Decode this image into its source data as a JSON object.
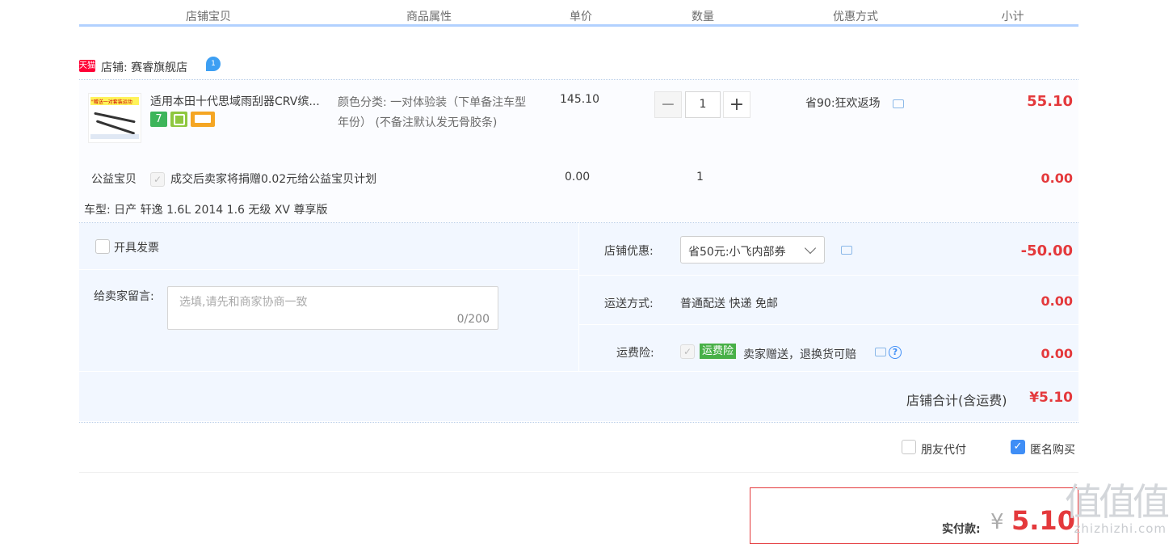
{
  "header": {
    "columns": [
      "店铺宝贝",
      "商品属性",
      "单价",
      "数量",
      "优惠方式",
      "小计"
    ]
  },
  "shop": {
    "badge": "天猫",
    "name": "店铺: 赛睿旗舰店",
    "chat_icon": "wangwang-chat-icon"
  },
  "item": {
    "thumbnail_caption": "\"赠送一对套装运动",
    "title": "适用本田十代思域雨刮器CRV缤...",
    "badges": [
      {
        "label": "7",
        "color": "#3db55a"
      },
      {
        "label": "",
        "color": "#8ec73f"
      },
      {
        "label": "",
        "color": "#f5a623"
      }
    ],
    "props": "颜色分类: 一对体验装（下单备注车型年份） (不备注默认发无骨胶条)",
    "unit_price": "145.10",
    "quantity": "1",
    "minus_label": "−",
    "plus_label": "+",
    "discount": "省90:狂欢返场",
    "subtotal": "55.10"
  },
  "charity": {
    "label": "公益宝贝",
    "check": "✓",
    "text": "成交后卖家将捐赠0.02元给公益宝贝计划",
    "price": "0.00",
    "quantity": "1",
    "subtotal": "0.00"
  },
  "vehicle": "车型: 日产 轩逸 1.6L 2014 1.6 无级 XV 尊享版",
  "options": {
    "invoice_label": "开具发票",
    "message_label": "给卖家留言:",
    "message_placeholder": "选填,请先和商家协商一致",
    "message_counter": "0/200",
    "coupon_label": "店铺优惠:",
    "coupon_value": "省50元:小飞内部券",
    "coupon_amount": "-50.00",
    "shipping_label": "运送方式:",
    "shipping_value": "普通配送 快递 免邮",
    "shipping_amount": "0.00",
    "insurance_label": "运费险:",
    "insurance_check": "✓",
    "insurance_badge": "运费险",
    "insurance_text": "卖家赠送，退换货可赔",
    "insurance_help": "?",
    "insurance_amount": "0.00",
    "shop_total_label": "店铺合计(含运费)",
    "shop_total_value": "¥5.10"
  },
  "footer_options": {
    "friend_pay_label": "朋友代付",
    "anonymous_label": "匿名购买",
    "anonymous_check": "✓"
  },
  "payment": {
    "label": "实付款:",
    "currency": "¥",
    "amount": "5.10"
  },
  "watermark": {
    "glyphs": "值值值",
    "site": "zhizhizhi.com"
  },
  "colors": {
    "accent_red": "#e4393c",
    "header_line": "#b2d1ff",
    "option_bg": "#f2f7ff",
    "checkbox_blue": "#3f8ef6",
    "tmall_red": "#ff0036"
  }
}
